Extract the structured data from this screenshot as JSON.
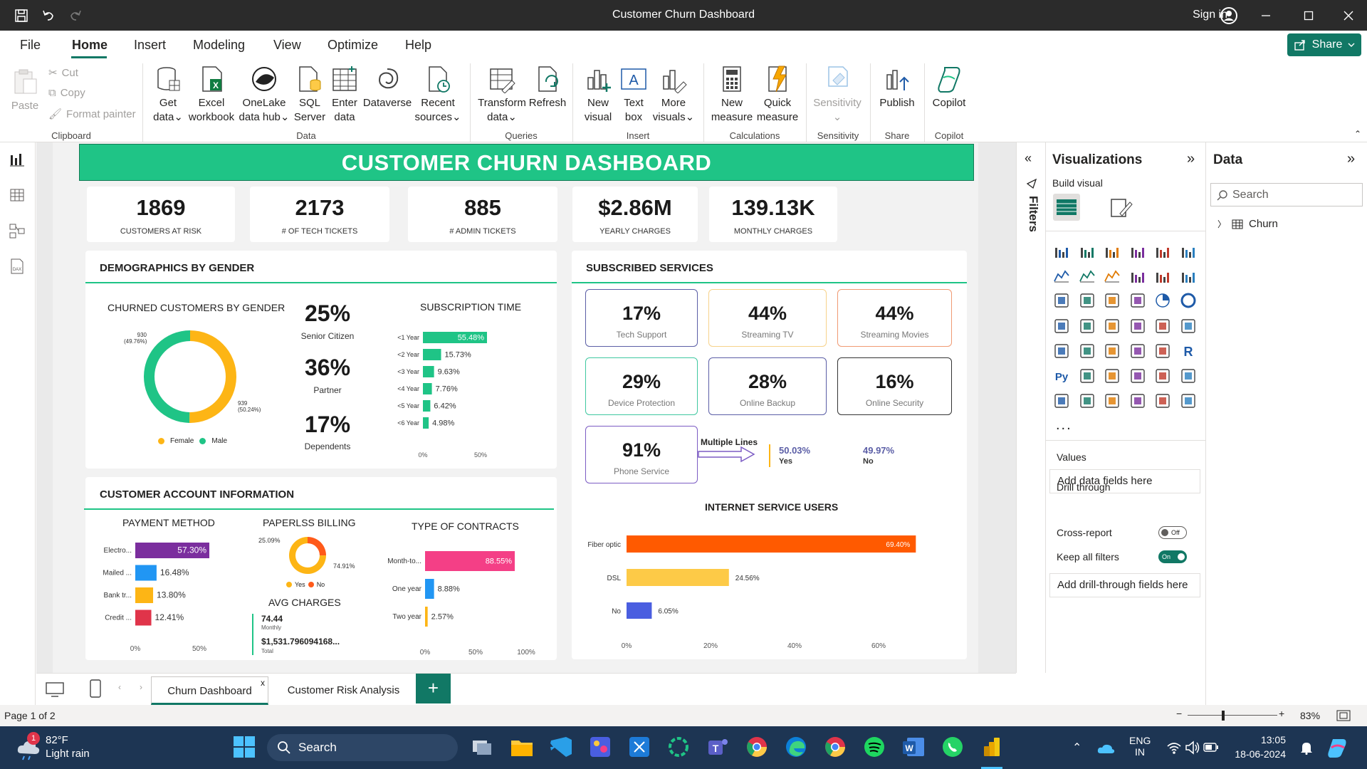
{
  "window": {
    "title": "Customer Churn Dashboard",
    "sign_in": "Sign in"
  },
  "menu": {
    "tabs": [
      "File",
      "Home",
      "Insert",
      "Modeling",
      "View",
      "Optimize",
      "Help"
    ],
    "share": "Share"
  },
  "ribbon": {
    "clipboard": {
      "paste": "Paste",
      "cut": "Cut",
      "copy": "Copy",
      "format_painter": "Format painter",
      "group": "Clipboard"
    },
    "data": {
      "get_data": [
        "Get",
        "data"
      ],
      "excel": [
        "Excel",
        "workbook"
      ],
      "onelake": [
        "OneLake",
        "data hub"
      ],
      "sql": [
        "SQL",
        "Server"
      ],
      "enter": [
        "Enter",
        "data"
      ],
      "dataverse": "Dataverse",
      "recent": [
        "Recent",
        "sources"
      ],
      "group": "Data"
    },
    "queries": {
      "transform": [
        "Transform",
        "data"
      ],
      "refresh": "Refresh",
      "group": "Queries"
    },
    "insert": {
      "new_visual": [
        "New",
        "visual"
      ],
      "text_box": [
        "Text",
        "box"
      ],
      "more_visuals": [
        "More",
        "visuals"
      ],
      "group": "Insert"
    },
    "calculations": {
      "new_measure": [
        "New",
        "measure"
      ],
      "quick_measure": [
        "Quick",
        "measure"
      ],
      "group": "Calculations"
    },
    "sensitivity": {
      "label": "Sensitivity",
      "group": "Sensitivity"
    },
    "share": {
      "publish": "Publish",
      "group": "Share"
    },
    "copilot": {
      "label": "Copilot",
      "group": "Copilot"
    }
  },
  "dashboard": {
    "title": "CUSTOMER CHURN DASHBOARD",
    "kpis": [
      {
        "value": "1869",
        "label": "CUSTOMERS AT RISK"
      },
      {
        "value": "2173",
        "label": "# OF TECH TICKETS"
      },
      {
        "value": "885",
        "label": "# ADMIN TICKETS"
      },
      {
        "value": "$2.86M",
        "label": "YEARLY CHARGES"
      },
      {
        "value": "139.13K",
        "label": "MONTHLY CHARGES"
      }
    ],
    "demographics": {
      "title": "DEMOGRAPHICS BY GENDER",
      "gender_title": "CHURNED CUSTOMERS BY GENDER",
      "female_label": "939",
      "female_pct": "(50.24%)",
      "male_label": "930",
      "male_pct": "(49.76%)",
      "legend": [
        "Female",
        "Male"
      ],
      "stats": [
        {
          "value": "25%",
          "label": "Senior Citizen"
        },
        {
          "value": "36%",
          "label": "Partner"
        },
        {
          "value": "17%",
          "label": "Dependents"
        }
      ],
      "subscription_title": "SUBSCRIPTION TIME",
      "axis": [
        "0%",
        "50%"
      ]
    },
    "account": {
      "title": "CUSTOMER ACCOUNT INFORMATION",
      "payment_title": "PAYMENT METHOD",
      "payment_axis": [
        "0%",
        "50%"
      ],
      "paperless_title": "PAPERLSS BILLING",
      "paperless_yes_label": "25.09%",
      "paperless_no_label": "74.91%",
      "paperless_legend": [
        "Yes",
        "No"
      ],
      "avg_title": "AVG CHARGES",
      "avg_monthly": "74.44",
      "avg_monthly_lbl": "Monthly",
      "avg_total": "$1,531.796094168...",
      "avg_total_lbl": "Total",
      "contracts_title": "TYPE OF CONTRACTS",
      "contracts_axis": [
        "0%",
        "50%",
        "100%"
      ]
    },
    "services": {
      "title": "SUBSCRIBED SERVICES",
      "cards": [
        {
          "value": "17%",
          "label": "Tech Support",
          "color": "#5b5ea6"
        },
        {
          "value": "44%",
          "label": "Streaming TV",
          "color": "#f7d28a"
        },
        {
          "value": "44%",
          "label": "Streaming Movies",
          "color": "#f09a73"
        },
        {
          "value": "29%",
          "label": "Device Protection",
          "color": "#3fc8a0"
        },
        {
          "value": "28%",
          "label": "Online Backup",
          "color": "#5b5ea6"
        },
        {
          "value": "16%",
          "label": "Online Security",
          "color": "#333333"
        },
        {
          "value": "91%",
          "label": "Phone Service",
          "color": "#7c5cc4"
        }
      ],
      "multiple_lines": "Multiple Lines",
      "ml_yes_value": "50.03%",
      "ml_yes_label": "Yes",
      "ml_no_value": "49.97%",
      "ml_no_label": "No",
      "internet_title": "INTERNET SERVICE USERS",
      "internet_axis": [
        "0%",
        "20%",
        "40%",
        "60%"
      ]
    }
  },
  "panes": {
    "filters": "Filters",
    "visualizations": "Visualizations",
    "build_visual": "Build visual",
    "values": "Values",
    "add_data_fields": "Add data fields here",
    "drill_through": "Drill through",
    "cross_report": "Cross-report",
    "cross_report_state": "Off",
    "keep_all_filters": "Keep all filters",
    "keep_state": "On",
    "add_drill": "Add drill-through fields here",
    "data": "Data",
    "search_placeholder": "Search",
    "table": "Churn"
  },
  "pages": {
    "tabs": [
      "Churn Dashboard",
      "Customer Risk Analysis"
    ],
    "status": "Page 1 of 2",
    "zoom": "83%"
  },
  "taskbar": {
    "temp": "82°F",
    "weather": "Light rain",
    "badge": "1",
    "search": "Search",
    "lang": [
      "ENG",
      "IN"
    ],
    "time": "13:05",
    "date": "18-06-2024"
  },
  "chart_data": [
    {
      "type": "pie",
      "title": "CHURNED CUSTOMERS BY GENDER",
      "categories": [
        "Female",
        "Male"
      ],
      "values": [
        939,
        930
      ],
      "percent": [
        50.24,
        49.76
      ],
      "colors": [
        "#fdb515",
        "#1fc486"
      ]
    },
    {
      "type": "bar",
      "title": "SUBSCRIPTION TIME",
      "categories": [
        "<1 Year",
        "<2 Year",
        "<3 Year",
        "<4 Year",
        "<5 Year",
        "<6 Year"
      ],
      "values": [
        55.48,
        15.73,
        9.63,
        7.76,
        6.42,
        4.98
      ],
      "labels": [
        "55.48%",
        "15.73%",
        "9.63%",
        "7.76%",
        "6.42%",
        "4.98%"
      ],
      "xlim": [
        0,
        55.48
      ],
      "color": "#1fc486"
    },
    {
      "type": "bar",
      "title": "PAYMENT METHOD",
      "categories": [
        "Electro...",
        "Mailed ...",
        "Bank tr...",
        "Credit ..."
      ],
      "values": [
        57.3,
        16.48,
        13.8,
        12.41
      ],
      "labels": [
        "57.30%",
        "16.48%",
        "13.80%",
        "12.41%"
      ],
      "xlim": [
        0,
        57.3
      ],
      "colors": [
        "#7b2e9e",
        "#2196f3",
        "#fdb515",
        "#e0344a"
      ]
    },
    {
      "type": "pie",
      "title": "PAPERLSS BILLING",
      "categories": [
        "Yes",
        "No"
      ],
      "values": [
        25.09,
        74.91
      ],
      "colors": [
        "#ff5a1a",
        "#fdb515"
      ]
    },
    {
      "type": "bar",
      "title": "TYPE OF CONTRACTS",
      "categories": [
        "Month-to...",
        "One year",
        "Two year"
      ],
      "values": [
        88.55,
        8.88,
        2.57
      ],
      "labels": [
        "88.55%",
        "8.88%",
        "2.57%"
      ],
      "xlim": [
        0,
        88.55
      ],
      "colors": [
        "#f43f86",
        "#2196f3",
        "#fdb515"
      ]
    },
    {
      "type": "bar",
      "title": "INTERNET SERVICE USERS",
      "categories": [
        "Fiber optic",
        "DSL",
        "No"
      ],
      "values": [
        69.4,
        24.56,
        6.05
      ],
      "labels": [
        "69.40%",
        "24.56%",
        "6.05%"
      ],
      "xlim": [
        0,
        69.4
      ],
      "colors": [
        "#ff5a00",
        "#fdca47",
        "#4a5ee0"
      ]
    }
  ]
}
